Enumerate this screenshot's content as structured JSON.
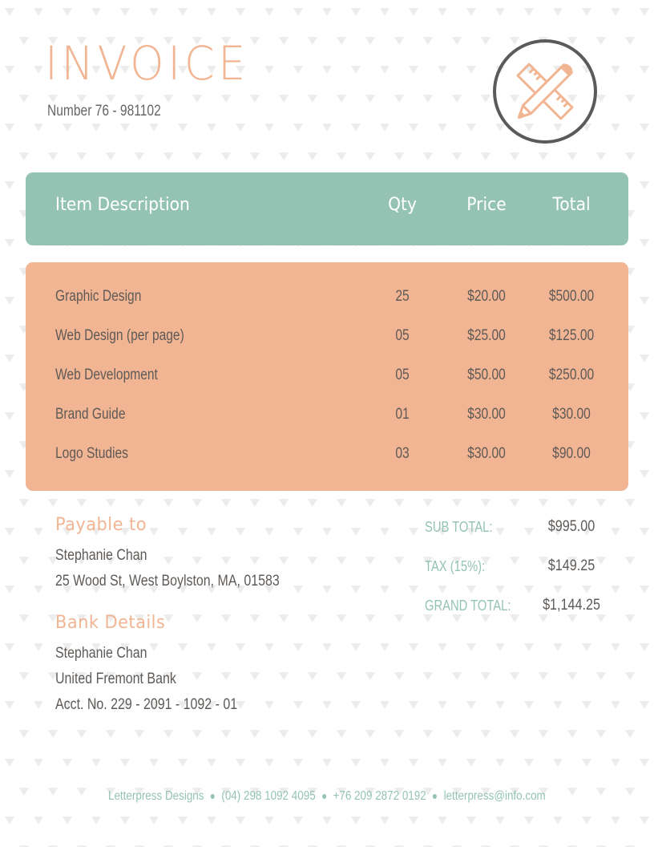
{
  "invoice": {
    "title": "INVOICE",
    "number": "Number 76 - 981102"
  },
  "logo": {
    "icon": "pencil-ruler-icon"
  },
  "table": {
    "headers": [
      "Item Description",
      "Qty",
      "Price",
      "Total"
    ],
    "rows": [
      {
        "description": "Graphic Design",
        "qty": "25",
        "price": "$20.00",
        "total": "$500.00"
      },
      {
        "description": "Web Design (per page)",
        "qty": "05",
        "price": "$25.00",
        "total": "$125.00"
      },
      {
        "description": "Web Development",
        "qty": "05",
        "price": "$50.00",
        "total": "$250.00"
      },
      {
        "description": "Brand Guide",
        "qty": "01",
        "price": "$30.00",
        "total": "$30.00"
      },
      {
        "description": "Logo Studies",
        "qty": "03",
        "price": "$30.00",
        "total": "$90.00"
      }
    ]
  },
  "payable": {
    "heading": "Payable to",
    "name": "Stephanie Chan",
    "address": "25 Wood St, West Boylston, MA, 01583"
  },
  "bank": {
    "heading": "Bank Details",
    "name": "Stephanie Chan",
    "bank_name": "United Fremont Bank",
    "account": "Acct. No. 229 - 2091 - 1092 - 01"
  },
  "summary": {
    "subtotal_label": "SUB TOTAL:",
    "subtotal": "$995.00",
    "tax_label": "TAX (15%):",
    "tax": "$149.25",
    "grand_label": "GRAND TOTAL:",
    "grand": "$1,144.25"
  },
  "footer": {
    "company": "Letterpress Designs",
    "phone1": "(04) 298 1092 4095",
    "phone2": "+76 209 2872 0192",
    "email": "letterpress@info.com"
  },
  "colors": {
    "accent_peach": "#f2b593",
    "accent_teal": "#94c3b4",
    "text": "#5e5a57"
  }
}
